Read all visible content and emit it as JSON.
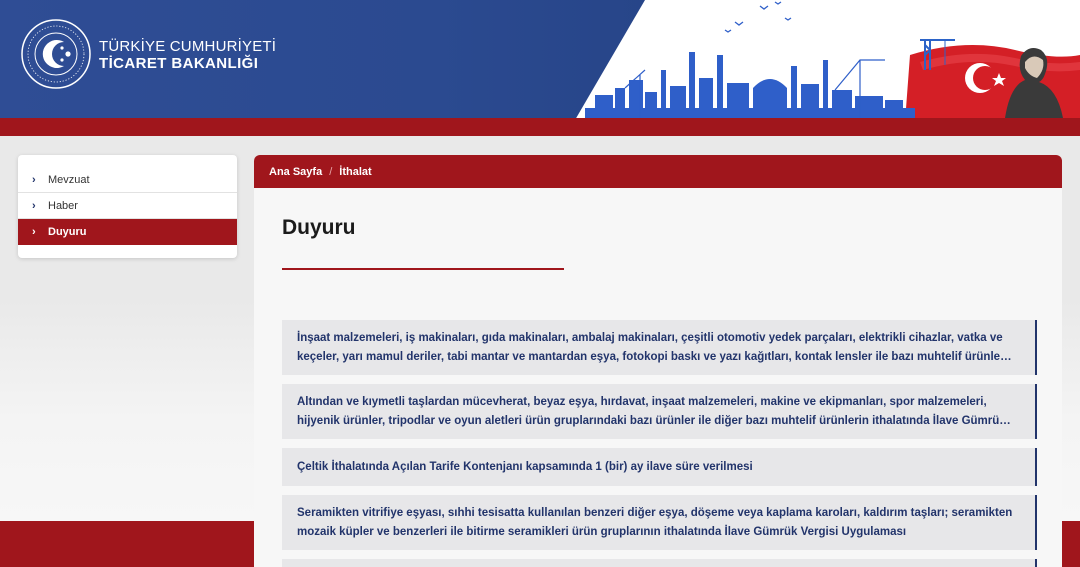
{
  "header": {
    "org_line1": "TÜRKİYE CUMHURİYETİ",
    "org_line2": "TİCARET BAKANLIĞI",
    "logo_icon": "ministry-emblem-icon",
    "banner_icon": "industrial-skyline-flag-icon"
  },
  "sidebar": {
    "items": [
      {
        "label": "Mevzuat",
        "active": false
      },
      {
        "label": "Haber",
        "active": false
      },
      {
        "label": "Duyuru",
        "active": true
      }
    ]
  },
  "breadcrumb": {
    "home": "Ana Sayfa",
    "separator": "/",
    "current": "İthalat"
  },
  "page": {
    "title": "Duyuru"
  },
  "announcements": [
    "İnşaat malzemeleri, iş makinaları, gıda makinaları, ambalaj makinaları, çeşitli otomotiv yedek parçaları, elektrikli cihazlar, vatka ve keçeler, yarı mamul deriler, tabi mantar ve mantardan eşya, fotokopi baskı ve yazı kağıtları, kontak lensler ile bazı muhtelif ürünlerin ithalatında İlave Gümrük Vergisi Uygulaması",
    "Altından ve kıymetli taşlardan mücevherat, beyaz eşya, hırdavat, inşaat malzemeleri, makine ve ekipmanları, spor malzemeleri, hijyenik ürünler, tripodlar ve oyun aletleri ürün gruplarındaki bazı ürünler ile diğer bazı muhtelif ürünlerin ithalatında İlave Gümrük Vergisi Uygulaması",
    "Çeltik İthalatında Açılan Tarife Kontenjanı kapsamında 1 (bir) ay ilave süre verilmesi",
    "Seramikten vitrifiye eşyası, sıhhi tesisatta kullanılan benzeri diğer eşya, döşeme veya kaplama karoları, kaldırım taşları; seramikten mozaik küpler ve benzerleri ile bitirme seramikleri ürün gruplarının ithalatında İlave Gümrük Vergisi Uygulaması"
  ],
  "colors": {
    "navy": "#22346b",
    "brand_red": "#a0161c",
    "header_blue": "#2b4a90"
  }
}
